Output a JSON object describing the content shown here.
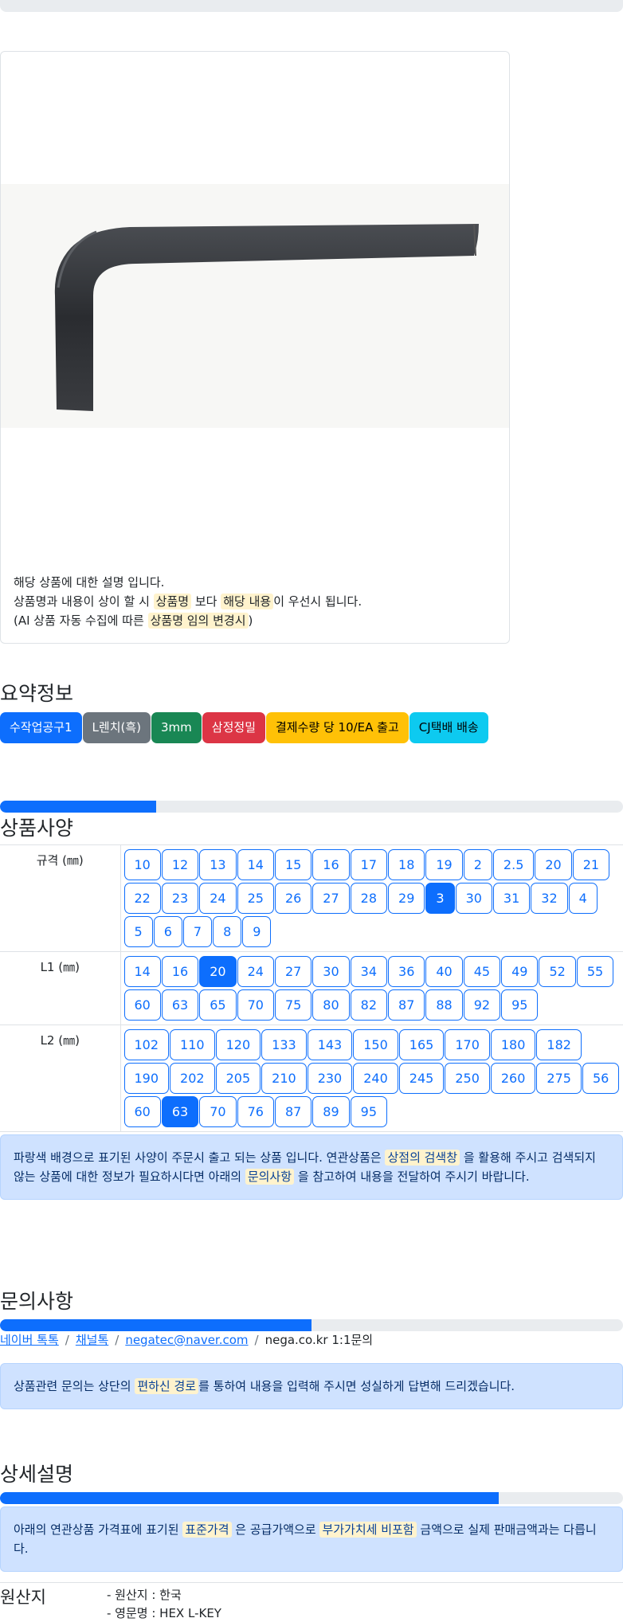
{
  "product": {
    "image_alt": "HEX L-KEY",
    "notice_line1": "해당 상품에 대한 설명 입니다.",
    "notice_line2_a": "상품명과 내용이 상이 할 시",
    "notice_line2_hl1": "상품명",
    "notice_line2_b": "보다",
    "notice_line2_hl2": "해당 내용",
    "notice_line2_c": "이 우선시 됩니다.",
    "notice_line3_a": "(AI 상품 자동 수집에 따른",
    "notice_line3_hl": "상품명 임의 변경시",
    "notice_line3_b": ")"
  },
  "summary": {
    "title": "요약정보",
    "badges": [
      {
        "label": "수작업공구1",
        "color": "#0d6efd"
      },
      {
        "label": "L렌치(흑)",
        "color": "#6c757d"
      },
      {
        "label": "3mm",
        "color": "#198754"
      },
      {
        "label": "삼정정밀",
        "color": "#dc3545"
      },
      {
        "label": "결제수량 당 10/EA 출고",
        "color": "#ffc107"
      },
      {
        "label": "CJ택배 배송",
        "color": "#0dcaf0"
      }
    ]
  },
  "spec": {
    "title": "상품사양",
    "progress": 0.25,
    "rows": [
      {
        "label": "규격 (㎜)",
        "options": [
          "10",
          "12",
          "13",
          "14",
          "15",
          "16",
          "17",
          "18",
          "19",
          "2",
          "2.5",
          "20",
          "21",
          "22",
          "23",
          "24",
          "25",
          "26",
          "27",
          "28",
          "29",
          "3",
          "30",
          "31",
          "32",
          "4",
          "5",
          "6",
          "7",
          "8",
          "9"
        ],
        "active": "3"
      },
      {
        "label": "L1 (㎜)",
        "options": [
          "14",
          "16",
          "20",
          "24",
          "27",
          "30",
          "34",
          "36",
          "40",
          "45",
          "49",
          "52",
          "55",
          "60",
          "63",
          "65",
          "70",
          "75",
          "80",
          "82",
          "87",
          "88",
          "92",
          "95"
        ],
        "active": "20"
      },
      {
        "label": "L2 (㎜)",
        "options": [
          "102",
          "110",
          "120",
          "133",
          "143",
          "150",
          "165",
          "170",
          "180",
          "182",
          "190",
          "202",
          "205",
          "210",
          "230",
          "240",
          "245",
          "250",
          "260",
          "275",
          "56",
          "60",
          "63",
          "70",
          "76",
          "87",
          "89",
          "95"
        ],
        "active": "63"
      }
    ],
    "notice_a": "파랑색 배경으로 표기된 사양이 주문시 출고 되는 상품 입니다. 연관상품은",
    "notice_hl1": "상점의 검색창",
    "notice_b": "을 활용해 주시고 검색되지 않는 상품에 대한 정보가 필요하시다면 아래의",
    "notice_hl2": "문의사항",
    "notice_c": "을 참고하여 내용을 전달하여 주시기 바랍니다."
  },
  "inquiry": {
    "title": "문의사항",
    "progress": 0.5,
    "links": [
      "네이버 톡톡",
      "채널톡",
      "negatec@naver.com"
    ],
    "last": "nega.co.kr 1:1문의",
    "notice_a": "상품관련 문의는 상단의",
    "notice_hl": "편하신 경로",
    "notice_b": "를 통하여 내용을 입력해 주시면 성실하게 답변해 드리겠습니다."
  },
  "detail": {
    "title": "상세설명",
    "progress": 0.8,
    "notice_a": "아래의 연관상품 가격표에 표기된",
    "notice_hl1": "표준가격",
    "notice_b": "은 공급가액으로",
    "notice_hl2": "부가가치세 비포함",
    "notice_c": "금액으로 실제 판매금액과는 다릅니다."
  },
  "origin": {
    "title": "원산지",
    "items": [
      "- 원산지 : 한국",
      "- 영문명 : HEX L-KEY"
    ]
  }
}
